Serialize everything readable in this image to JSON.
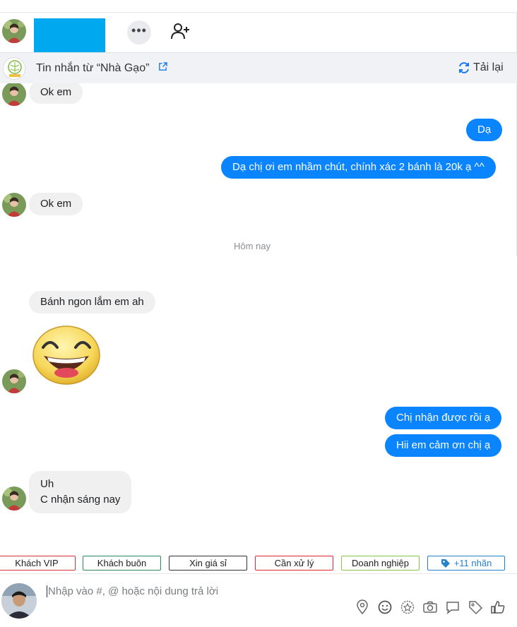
{
  "header": {
    "contact_name": "",
    "more_label": "•••"
  },
  "banner": {
    "source_text": "Tin nhắn từ  “Nhà Gạo”",
    "reload_label": "Tải lại"
  },
  "messages": {
    "m1": "Ok em",
    "m2": "Dạ",
    "m3": "Dạ chị ơi em nhầm chút, chính xác 2 bánh là 20k ạ ^^",
    "m4": "Ok em",
    "day_separator": "Hôm nay",
    "m5": "Bánh ngon lắm em ah",
    "m6": "Chị nhận được rồi ạ",
    "m7": "Hii em cảm ơn chị ạ",
    "m8_line1": "Uh",
    "m8_line2": "C nhận sáng nay"
  },
  "tags": [
    {
      "label": "Khách VIP",
      "color": "#d13438"
    },
    {
      "label": "Khách buôn",
      "color": "#2e8b57"
    },
    {
      "label": "Xin giá sỉ",
      "color": "#333333"
    },
    {
      "label": "Cần xử lý",
      "color": "#e0282e"
    },
    {
      "label": "Doanh nghiệp",
      "color": "#8bc34a"
    },
    {
      "label": "+11 nhãn",
      "color": "#2481cc"
    }
  ],
  "composer": {
    "placeholder": "Nhập vào #, @ hoặc nội dung trả lời",
    "tools": [
      "location-icon",
      "emoji-icon",
      "sticker-icon",
      "camera-icon",
      "chat-icon",
      "tag-icon",
      "like-icon"
    ]
  },
  "colors": {
    "outgoing_bubble": "#0a84ff",
    "incoming_bubble": "#f0f0f0",
    "header_name_block": "#00a8f0",
    "reload_icon": "#1877f2"
  }
}
